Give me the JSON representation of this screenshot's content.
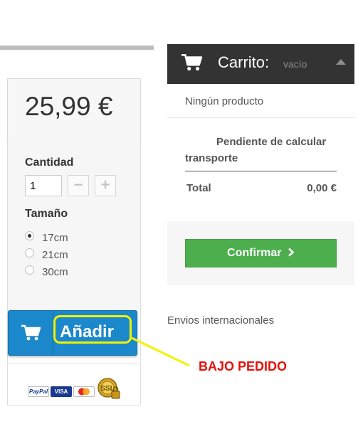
{
  "product": {
    "price": "25,99 €",
    "quantity_label": "Cantidad",
    "quantity_value": "1",
    "minus_symbol": "−",
    "plus_symbol": "+",
    "size_label": "Tamaño",
    "sizes": [
      {
        "label": "17cm",
        "selected": true
      },
      {
        "label": "21cm",
        "selected": false
      },
      {
        "label": "30cm",
        "selected": false
      }
    ],
    "add_button_label": "Añadir",
    "add_button_icon": "cart-icon",
    "payment_logos": [
      "PayPal",
      "VISA",
      "MasterCard",
      "SSL"
    ]
  },
  "annotation": {
    "text": "BAJO PEDIDO",
    "color": "#e3120b",
    "highlight_color": "#f2f200"
  },
  "cart": {
    "title": "Carrito:",
    "state": "vacío",
    "no_products": "Ningún producto",
    "shipping_text": "Pendiente de calcular transporte",
    "total_label": "Total",
    "total_value": "0,00 €",
    "confirm_label": "Confirmar",
    "confirm_color": "#4cae4c"
  },
  "footer": {
    "international": "Envios internacionales"
  }
}
